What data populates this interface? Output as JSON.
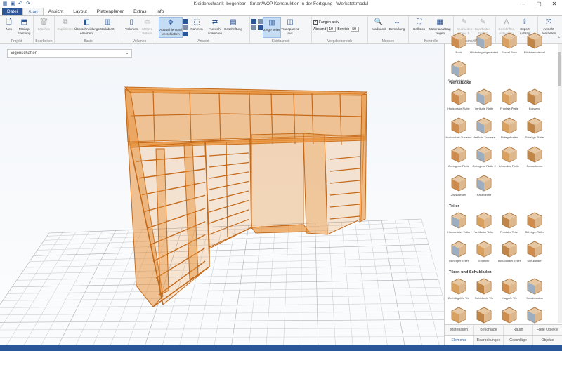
{
  "window": {
    "title": "Kleiderschrank_begehbar - SmartWOP Konstruktion in der Fertigung - Werkstattmodul",
    "controls": {
      "minimize": "–",
      "maximize": "▢",
      "close": "✕"
    }
  },
  "tabs": [
    "Datei",
    "Start",
    "Ansicht",
    "Layout",
    "Plattenplaner",
    "Extras",
    "Info"
  ],
  "ribbon": {
    "groups": [
      {
        "label": "Projekt",
        "buttons": [
          {
            "label": "Neu",
            "icon": "new-doc-icon"
          },
          {
            "label": "Minitap Formung",
            "icon": "minitap-icon"
          }
        ]
      },
      {
        "label": "Bearbeiten",
        "buttons": [
          {
            "label": "Löschen",
            "icon": "trash-icon",
            "disabled": true
          }
        ]
      },
      {
        "label": "Basis",
        "buttons": [
          {
            "label": "Duplizieren",
            "icon": "duplicate-icon",
            "disabled": true
          },
          {
            "label": "Überschneidungen erlauben",
            "icon": "overlap-icon"
          },
          {
            "label": "Kollabiert",
            "icon": "collapse-icon"
          }
        ]
      },
      {
        "label": "Volumen",
        "buttons": [
          {
            "label": "Volumen",
            "icon": "volume-icon"
          },
          {
            "label": "Mittlere Wände",
            "icon": "walls-icon",
            "disabled": true
          }
        ]
      },
      {
        "label": "Ansicht",
        "buttons": [
          {
            "label": "Auswählen und Verschieben",
            "icon": "move-icon",
            "selected": true
          },
          {
            "label": "Rahmen",
            "icon": "frame-icon"
          },
          {
            "label": "Auswahl umkehren",
            "icon": "invert-icon"
          },
          {
            "label": "Beschriftung",
            "icon": "label-icon"
          }
        ]
      },
      {
        "label": "Sichtbarkeit",
        "buttons": [
          {
            "label": "Zeige Teiler",
            "icon": "divider-icon",
            "selected": true
          },
          {
            "label": "Transparenz aus",
            "icon": "transparency-icon"
          }
        ]
      },
      {
        "label": "Vorgabebereich",
        "fangen": "Fangen aktiv",
        "abstand_label": "Abstand",
        "abstand_value": "10",
        "bereich_label": "Bereich",
        "bereich_value": "50"
      },
      {
        "label": "Messen",
        "buttons": [
          {
            "label": "Maßband",
            "icon": "measure-icon"
          },
          {
            "label": "Bemaßung",
            "icon": "dimension-icon"
          }
        ]
      },
      {
        "label": "Kontrolle",
        "buttons": [
          {
            "label": "Kollision",
            "icon": "collision-icon"
          },
          {
            "label": "Materialauftrag zeigen",
            "icon": "material-icon"
          }
        ]
      },
      {
        "label": "smartWOP",
        "buttons": [
          {
            "label": "Bearbeiten Teile 1",
            "icon": "edit-parts-icon",
            "disabled": true
          },
          {
            "label": "Bearbeiten Teile 2",
            "icon": "edit-parts-icon",
            "disabled": true
          }
        ]
      },
      {
        "label": "",
        "buttons": [
          {
            "label": "Beschriften aktivieren",
            "icon": "text-icon",
            "disabled": true
          },
          {
            "label": "Export Auftrag",
            "icon": "export-icon"
          }
        ]
      },
      {
        "label": "",
        "buttons": [
          {
            "label": "Ansicht zentrieren",
            "icon": "center-view-icon"
          }
        ]
      }
    ]
  },
  "viewport": {
    "properties_label": "Eigenschaften"
  },
  "library": {
    "top_items": [
      "Bock",
      "Rückwing abgewinkelt",
      "Sockel Bock",
      "Rückwanddeckel"
    ],
    "extra_item": "Sockelfarbblende",
    "categories": [
      {
        "name": "Werkstücke",
        "items": [
          "Horizontale Platte",
          "Vertikale Platte",
          "Frontale Platte",
          "Eckwand",
          "Horizontale Traverse",
          "Vertikale Traverse",
          "Einlegeboden",
          "Schräge Platte",
          "Gebogene Platte",
          "Gebogene Platte 2",
          "Umlenkte Platte",
          "Schrankecke",
          "Zwischenteil",
          "Passbleche"
        ]
      },
      {
        "name": "Teiler",
        "items": [
          "Horizontaler Teiler",
          "Vertikaler Teiler",
          "Frontaler Teiler",
          "Schräger Teiler",
          "Geneigter Teiler",
          "Eckteiler",
          "Horizontaler Teiler",
          "Schubladen"
        ]
      },
      {
        "name": "Türen und Schubladen",
        "items": [
          "Drehflügeltür Tür",
          "Schiebetür Tür",
          "Klapptür Tür",
          "Schubkasten",
          "Schiebetür",
          "Aufdoppelung",
          "Kulisse",
          "Aufdoppelung Front"
        ]
      }
    ],
    "tabs_top": [
      "Materialien",
      "Beschläge",
      "Raum",
      "Freie Objekte"
    ],
    "tabs_bottom": [
      "Elemente",
      "Bearbeitungen",
      "Geschläge",
      "Objekte"
    ]
  },
  "colors": {
    "accent": "#2b579a",
    "cabinet": "#e8923a",
    "cabinet_edge": "#c46a1a"
  }
}
